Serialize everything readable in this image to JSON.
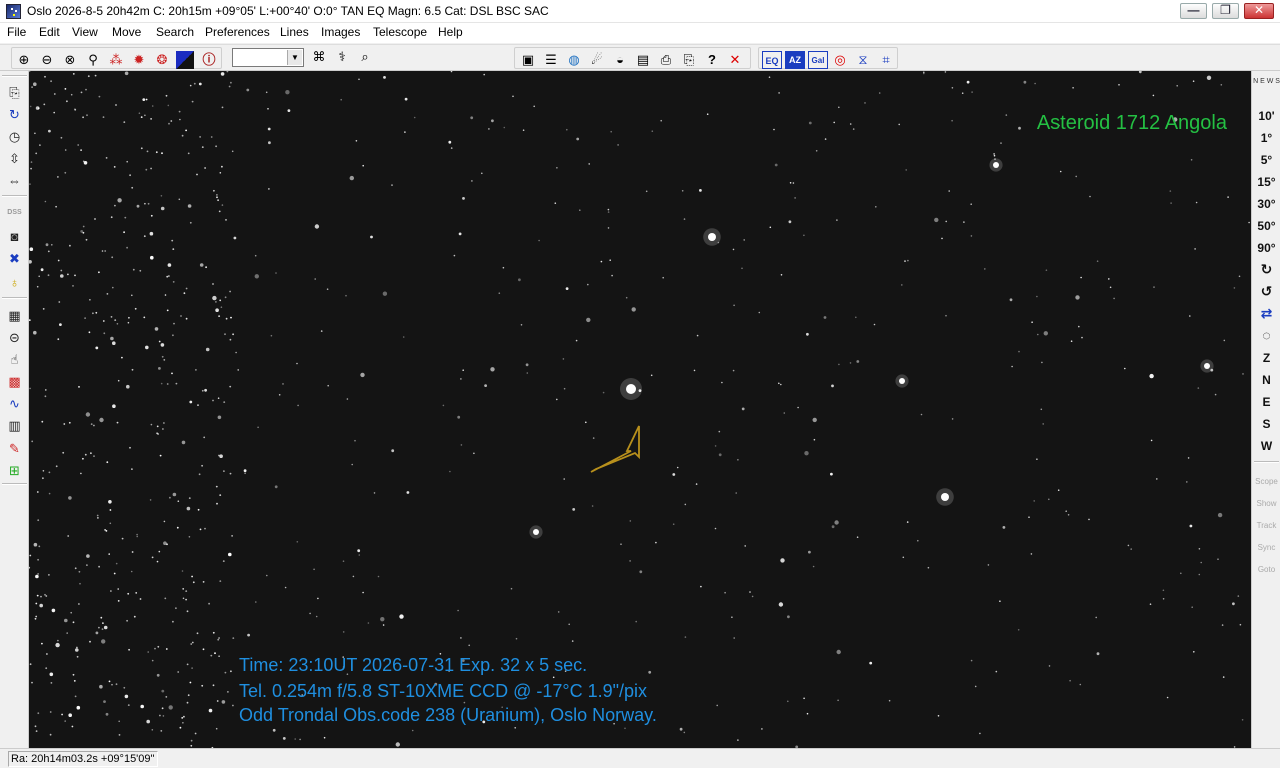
{
  "window": {
    "title": "Oslo 2026-8-5  20h42m C: 20h15m +09°05' L:+00°40' O:0° TAN EQ Magn: 6.5 Cat: DSL BSC SAC",
    "controls": {
      "minimize": "—",
      "maximize": "❐",
      "close": "✕"
    }
  },
  "menu": {
    "items": [
      "File",
      "Edit",
      "View",
      "Move",
      "Search",
      "Preferences",
      "Lines",
      "Images",
      "Telescope",
      "Help"
    ]
  },
  "toolbar": {
    "left_icons": [
      "zoom-in-icon",
      "zoom-out-icon",
      "zoom-fit-icon",
      "search-icon",
      "constellation-icon",
      "settings-icon",
      "color-icon",
      "night-mode-icon",
      "info-icon"
    ],
    "fov_combo_value": "",
    "search_icons": [
      "binoculars-icon",
      "find-object-icon",
      "magnify-icon"
    ],
    "file_icons": [
      "save-icon",
      "list-icon",
      "globe-icon",
      "telescope-icon",
      "chart-icon",
      "calendar-icon",
      "print-icon",
      "print-setup-icon",
      "help-icon",
      "close-icon"
    ],
    "projection_labels": [
      "EQ",
      "AZ",
      "Gal"
    ],
    "projection_icons": [
      "target-icon",
      "mirror-icon",
      "grid-icon"
    ]
  },
  "left_panel": {
    "icons": [
      "copy-icon",
      "refresh-icon",
      "clock-icon",
      "orientation-icon",
      "rotate-icon",
      "dss-icon",
      "camera-icon",
      "grid-icon",
      "lightbulb-icon",
      "objects-icon",
      "circle-icon",
      "pointer-icon",
      "color-pick-icon",
      "wave-icon",
      "document-icon",
      "pencil-icon",
      "add-image-icon"
    ],
    "dss_label": "DSS"
  },
  "right_panel": {
    "compass_label": "N  E  W  S",
    "fov_buttons": [
      "10'",
      "1°",
      "5°",
      "15°",
      "30°",
      "50°",
      "90°"
    ],
    "direction_buttons": [
      "Z",
      "N",
      "E",
      "S",
      "W"
    ],
    "telescope_buttons": [
      "Scope",
      "Show",
      "Track",
      "Sync",
      "Goto"
    ]
  },
  "sky_view": {
    "object_label": "Asteroid 1712 Angola",
    "info_lines": [
      "Time: 23:10UT  2026-07-31  Exp. 32 x 5 sec.",
      "Tel. 0.254m f/5.8 ST-10XME CCD @ -17°C  1.9\"/pix",
      "Odd Trondal Obs.code 238 (Uranium), Oslo Norway."
    ],
    "colors": {
      "label": "#24c043",
      "info": "#1f8fe0",
      "arrow": "#b8901c",
      "background": "#141414"
    }
  },
  "statusbar": {
    "coordinates": "Ra: 20h14m03.2s +09°15'09\""
  }
}
